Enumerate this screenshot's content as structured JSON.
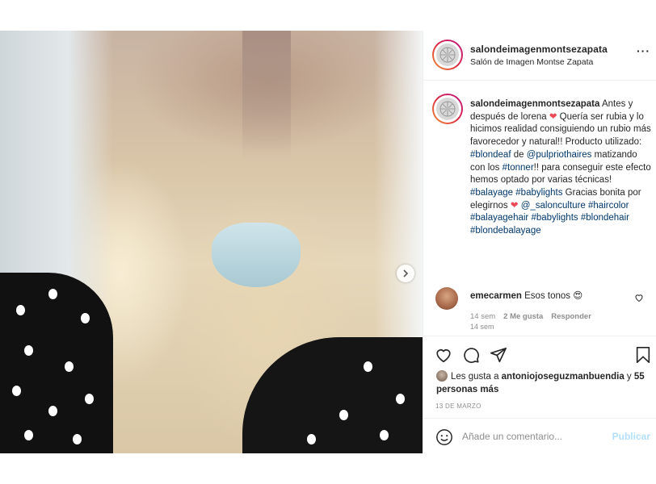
{
  "post": {
    "username": "salondeimagenmontsezapata",
    "location": "Salón de Imagen Montse Zapata",
    "more_icon": "more-options-icon",
    "caption": {
      "username": "salondeimagenmontsezapata",
      "t1": " Antes y después de lorena ",
      "heart1": "❤",
      "t2": " Quería ser rubia y lo hicimos realidad consiguiendo un rubio más favorecedor y natural!! Producto utilizado: ",
      "tag_blondeaf": "#blondeaf",
      "t3": " de ",
      "mention_pulprio": "@pulpriothaires",
      "t4": " matizando con los ",
      "tag_tonner": "#tonner",
      "t5": "!! para conseguir este efecto hemos optado por varias técnicas! ",
      "tag_balayage": "#balayage",
      "t6": " ",
      "tag_babylights": "#babylights",
      "t7": " Gracias bonita por elegirnos ",
      "heart2": "❤",
      "t8": " ",
      "mention_salon": "@_salonculture",
      "t9": " ",
      "tag_haircolor": "#haircolor",
      "t10": " ",
      "tag_balayagehair": "#balayagehair",
      "t11": " ",
      "tag_babylights2": "#babylights",
      "t12": " ",
      "tag_blondehair": "#blondehair",
      "t13": " ",
      "tag_blondebalayage": "#blondebalayage",
      "time": "14 sem"
    },
    "comment": {
      "username": "emecarmen",
      "text": " Esos tonos ",
      "emoji": "😍",
      "time": "14 sem",
      "likes": "2 Me gusta",
      "reply": "Responder"
    },
    "likes": {
      "prefix": "Les gusta a ",
      "user": "antoniojoseguzmanbuendia",
      "mid": " y ",
      "others": "55 personas más"
    },
    "date": "13 DE MARZO",
    "add_comment": {
      "placeholder": "Añade un comentario...",
      "post_label": "Publicar"
    }
  },
  "colors": {
    "link": "#00376b",
    "heart": "#ed4956",
    "publish_disabled": "#b2dffc",
    "carousel_active": "#3897f0"
  }
}
